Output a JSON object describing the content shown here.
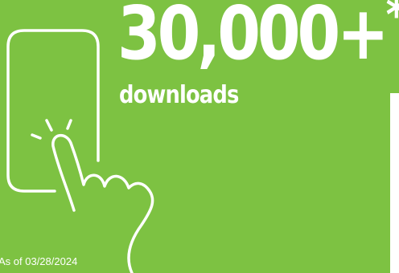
{
  "colors": {
    "background": "#7dc242",
    "text": "#ffffff",
    "line_art": "#ffffff",
    "right_bar": "#ffffff"
  },
  "icons": {
    "phone": "smartphone-outline-icon",
    "hand": "tapping-hand-icon",
    "tap_rays": "tap-burst-lines-icon"
  },
  "stat": {
    "value": "30,000+",
    "footnote_mark": "*",
    "label": "downloads"
  },
  "footnote": "As of 03/28/2024"
}
